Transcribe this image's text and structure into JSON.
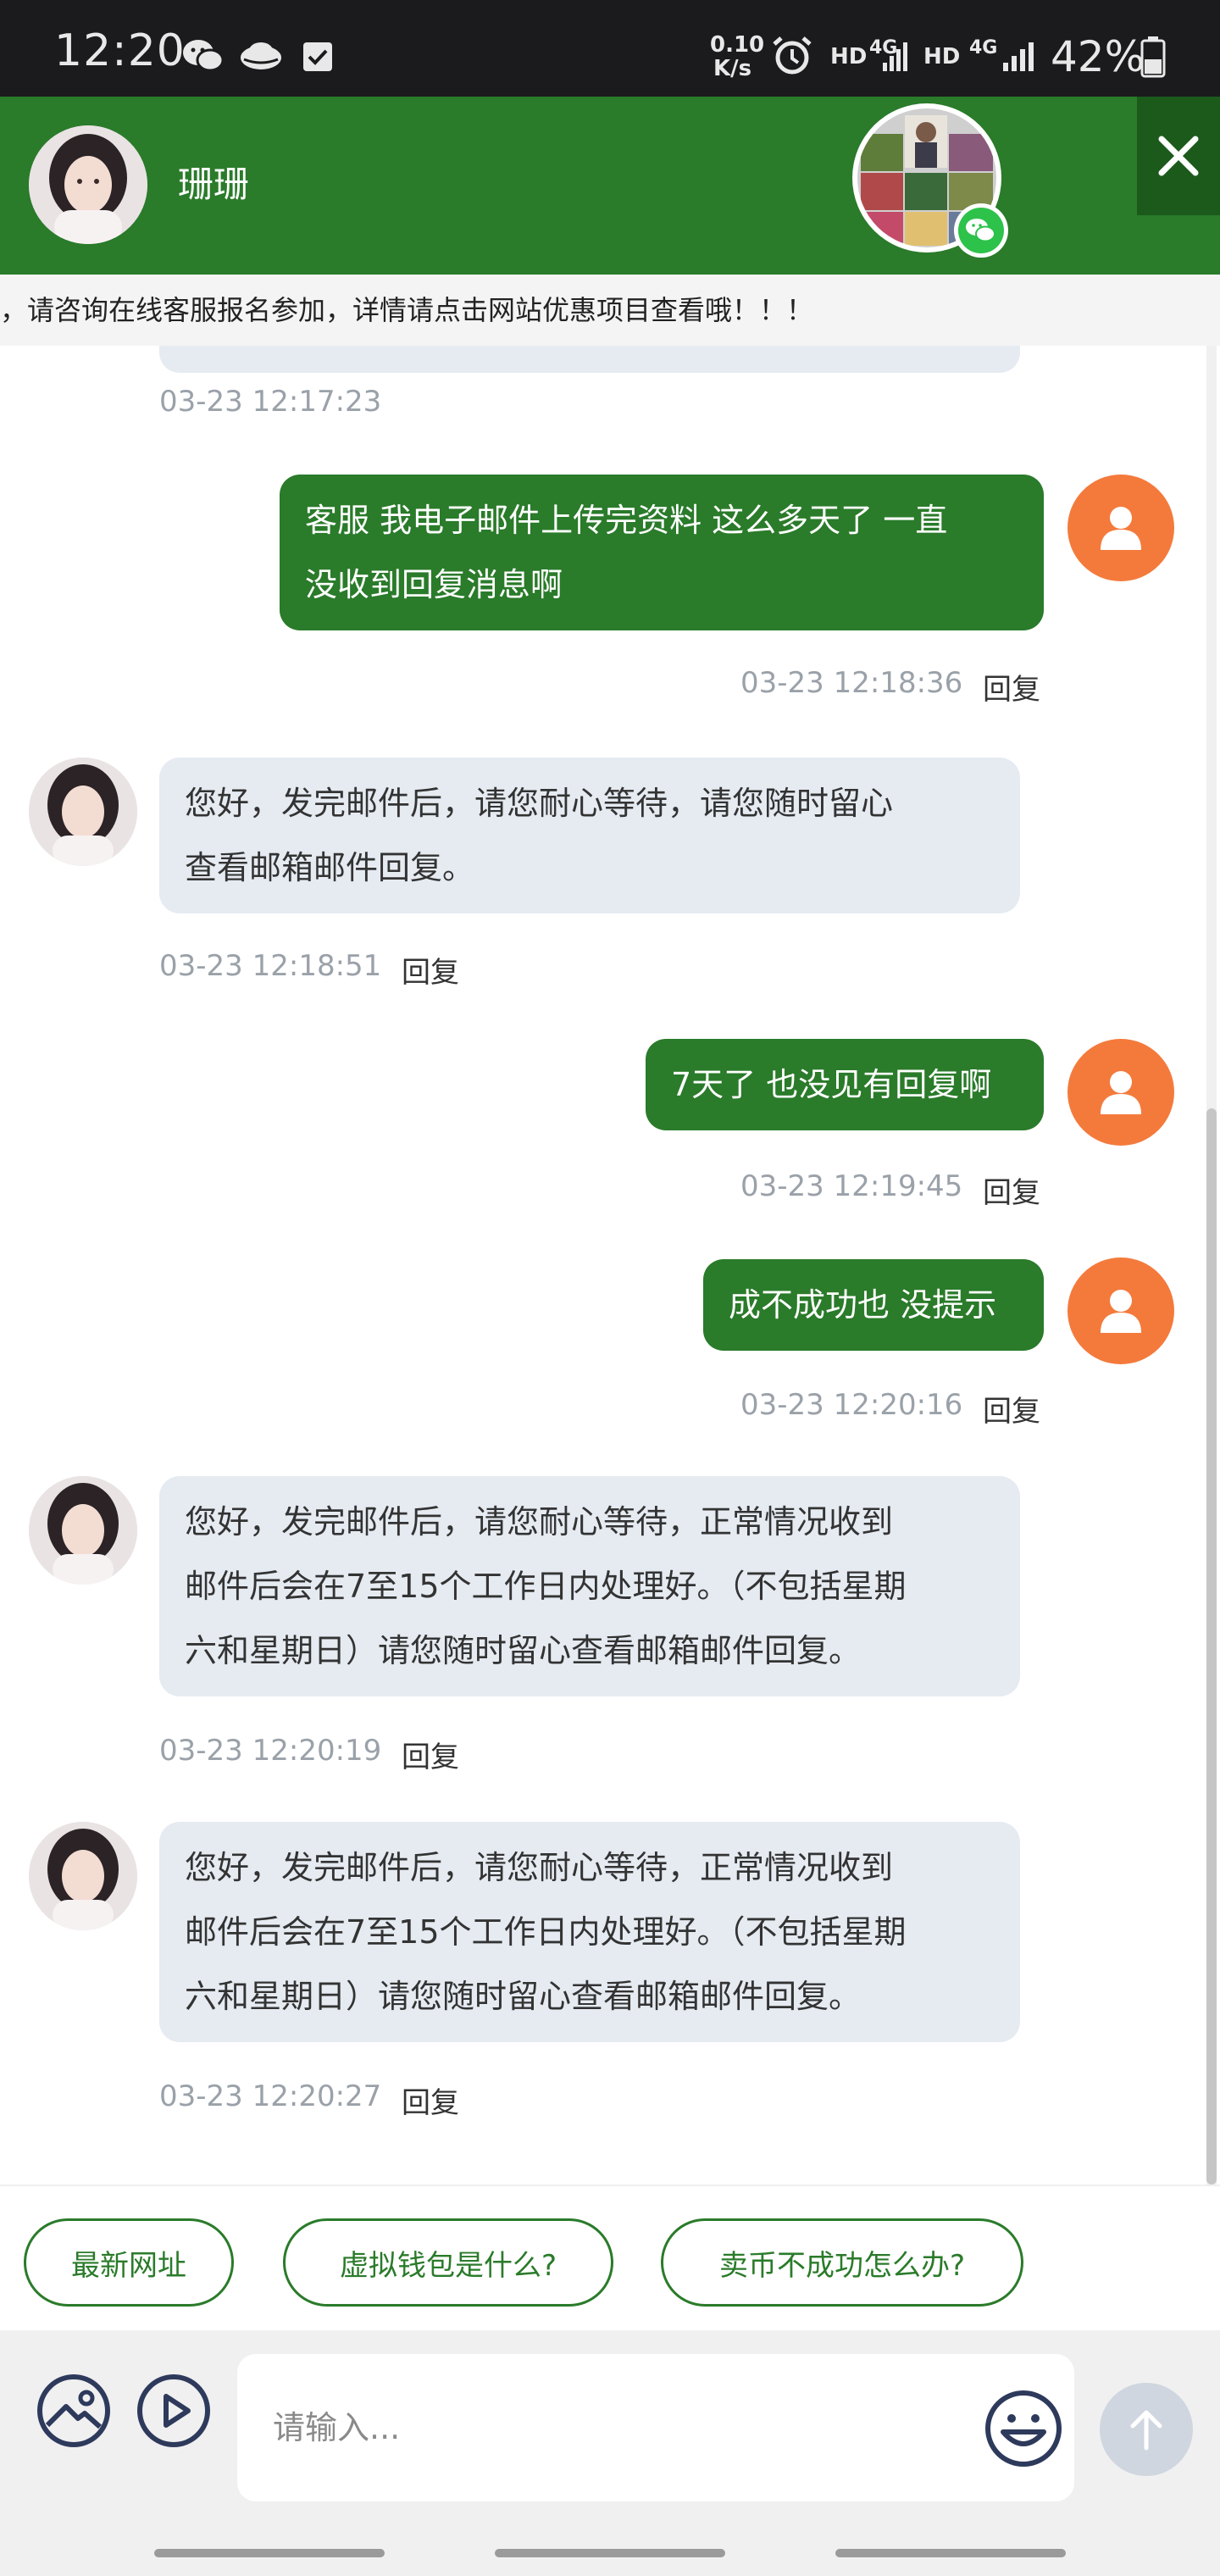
{
  "status_bar": {
    "time": "12:20",
    "net_speed_value": "0.10",
    "net_speed_unit": "K/s",
    "hd1": "HD",
    "net1": "4G",
    "hd2": "HD",
    "net2": "4G",
    "battery": "42%",
    "icons": [
      "wechat-icon",
      "cloud-icon",
      "checkbox-icon",
      "alarm-icon",
      "signal-icon",
      "battery-icon"
    ]
  },
  "header": {
    "agent_name": "珊珊",
    "close_icon": "close-icon",
    "qr_badge_icon": "wechat-icon"
  },
  "marquee": {
    "text": "，请咨询在线客服报名参加，详情请点击网站优惠项目查看哦！！！"
  },
  "messages": [
    {
      "id": "m0",
      "side": "in",
      "text": "",
      "time": "03-23 12:17:23",
      "reply": ""
    },
    {
      "id": "m1",
      "side": "out",
      "lines": [
        "客服 我电子邮件上传完资料 这么多天了 一直",
        "没收到回复消息啊"
      ],
      "time": "03-23 12:18:36",
      "reply": "回复"
    },
    {
      "id": "m2",
      "side": "in",
      "lines": [
        "您好，发完邮件后，请您耐心等待，请您随时留心",
        "查看邮箱邮件回复。"
      ],
      "time": "03-23 12:18:51",
      "reply": "回复"
    },
    {
      "id": "m3",
      "side": "out",
      "lines": [
        "7天了 也没见有回复啊"
      ],
      "time": "03-23 12:19:45",
      "reply": "回复"
    },
    {
      "id": "m4",
      "side": "out",
      "lines": [
        "成不成功也 没提示"
      ],
      "time": "03-23 12:20:16",
      "reply": "回复"
    },
    {
      "id": "m5",
      "side": "in",
      "lines": [
        "您好，发完邮件后，请您耐心等待，正常情况收到",
        "邮件后会在7至15个工作日内处理好。（不包括星期",
        "六和星期日）请您随时留心查看邮箱邮件回复。"
      ],
      "time": "03-23 12:20:19",
      "reply": "回复"
    },
    {
      "id": "m6",
      "side": "in",
      "lines": [
        "您好，发完邮件后，请您耐心等待，正常情况收到",
        "邮件后会在7至15个工作日内处理好。（不包括星期",
        "六和星期日）请您随时留心查看邮箱邮件回复。"
      ],
      "time": "03-23 12:20:27",
      "reply": "回复"
    }
  ],
  "quick_replies": [
    "最新网址",
    "虚拟钱包是什么?",
    "卖币不成功怎么办?"
  ],
  "input": {
    "placeholder": "请输入...",
    "value": "",
    "icons": [
      "image-icon",
      "video-icon",
      "emoji-icon",
      "send-arrow-icon"
    ]
  },
  "colors": {
    "header_green": "#2a7b2a",
    "out_bubble": "#2a7b2a",
    "in_bubble": "#e6ebf2",
    "user_avatar": "#f47a3c",
    "send_button": "#cfd6df"
  }
}
